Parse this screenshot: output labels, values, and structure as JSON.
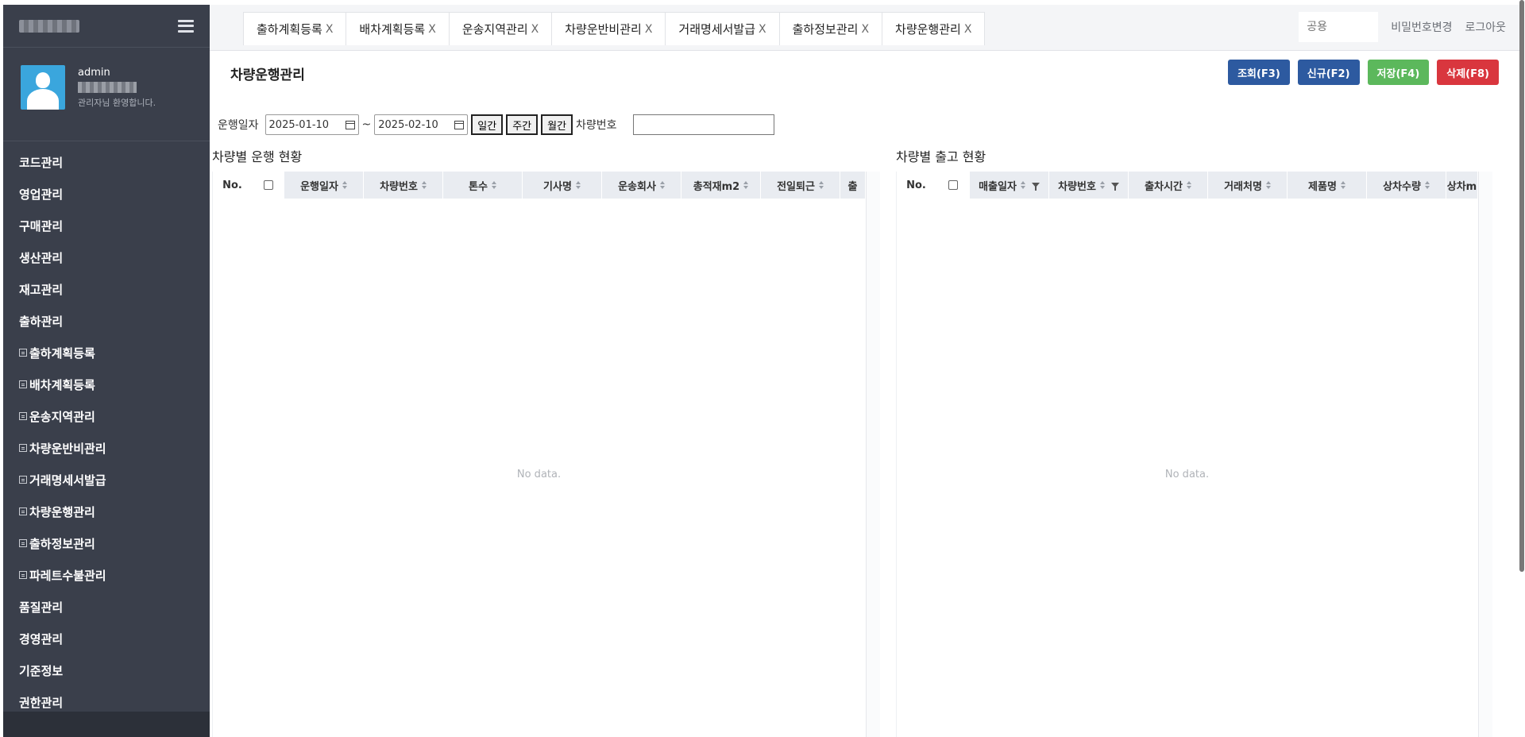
{
  "sidebar": {
    "user_name": "admin",
    "welcome": "관리자님 환영합니다.",
    "menu": [
      {
        "label": "코드관리",
        "sub": false
      },
      {
        "label": "영업관리",
        "sub": false
      },
      {
        "label": "구매관리",
        "sub": false
      },
      {
        "label": "생산관리",
        "sub": false
      },
      {
        "label": "재고관리",
        "sub": false
      },
      {
        "label": "출하관리",
        "sub": false
      },
      {
        "label": "출하계획등록",
        "sub": true
      },
      {
        "label": "배차계획등록",
        "sub": true
      },
      {
        "label": "운송지역관리",
        "sub": true
      },
      {
        "label": "차량운반비관리",
        "sub": true
      },
      {
        "label": "거래명세서발급",
        "sub": true
      },
      {
        "label": "차량운행관리",
        "sub": true
      },
      {
        "label": "출하정보관리",
        "sub": true
      },
      {
        "label": "파레트수불관리",
        "sub": true
      },
      {
        "label": "품질관리",
        "sub": false
      },
      {
        "label": "경영관리",
        "sub": false
      },
      {
        "label": "기준정보",
        "sub": false
      },
      {
        "label": "권한관리",
        "sub": false
      }
    ]
  },
  "tabs": [
    {
      "label": "출하계획등록",
      "close": "X"
    },
    {
      "label": "배차계획등록",
      "close": "X"
    },
    {
      "label": "운송지역관리",
      "close": "X"
    },
    {
      "label": "차량운반비관리",
      "close": "X"
    },
    {
      "label": "거래명세서발급",
      "close": "X"
    },
    {
      "label": "출하정보관리",
      "close": "X"
    },
    {
      "label": "차량운행관리",
      "close": "X"
    }
  ],
  "topbar": {
    "input_placeholder": "공용",
    "change_password": "비밀번호변경",
    "logout": "로그아웃"
  },
  "page": {
    "title": "차량운행관리",
    "actions": {
      "search": "조회(F3)",
      "new": "신규(F2)",
      "save": "저장(F4)",
      "delete": "삭제(F8)"
    }
  },
  "filters": {
    "date_label": "운행일자",
    "date_from": "2025-01-10",
    "tilde": "~",
    "date_to": "2025-02-10",
    "daily": "일간",
    "weekly": "주간",
    "monthly": "월간",
    "car_label": "차량번호",
    "car_value": ""
  },
  "left_grid": {
    "title": "차량별 운행 현황",
    "columns": [
      "No.",
      "",
      "운행일자",
      "차량번호",
      "톤수",
      "기사명",
      "운송회사",
      "총적재m2",
      "전일퇴근",
      "출"
    ],
    "no_data": "No data."
  },
  "right_grid": {
    "title": "차량별 출고 현황",
    "columns": [
      "No.",
      "",
      "매출일자",
      "차량번호",
      "출차시간",
      "거래처명",
      "제품명",
      "상차수량",
      "상차m"
    ],
    "no_data": "No data."
  },
  "colors": {
    "sidebar_bg": "#3a3f4b",
    "search_btn": "#2d5aa0",
    "save_btn": "#5cb85c",
    "delete_btn": "#d9363e"
  }
}
